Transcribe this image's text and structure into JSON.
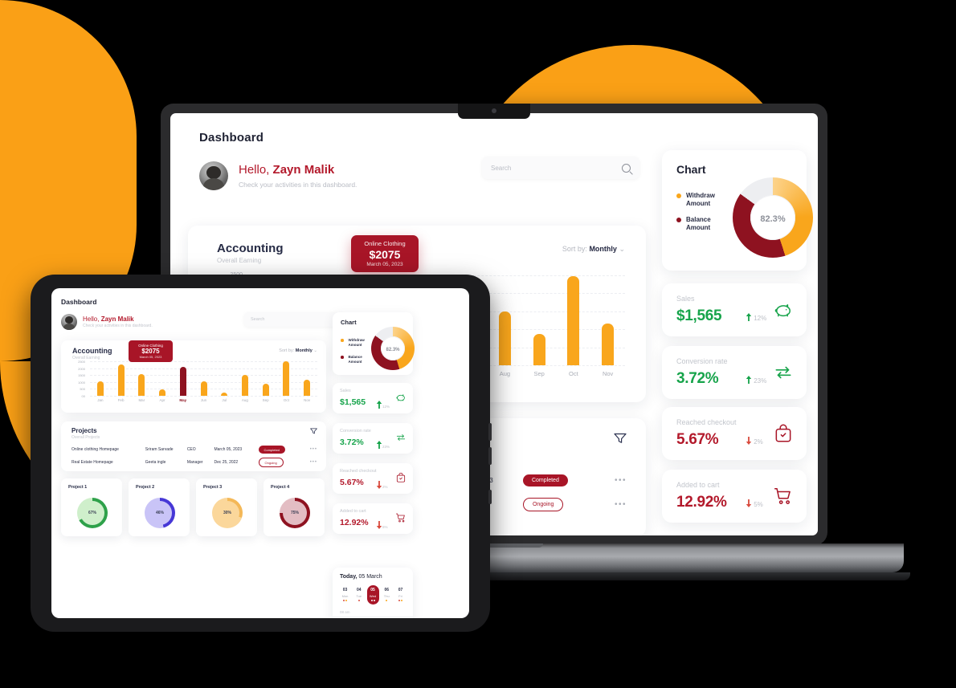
{
  "brand": {
    "orange": "#FAA016",
    "red": "#A81527",
    "dark_red": "#8E1220",
    "green": "#17A44B",
    "navy": "#262b45"
  },
  "app": {
    "page_title": "Dashboard",
    "greeting_prefix": "Hello,",
    "user_name": "Zayn Malik",
    "greeting_sub": "Check your activities in this dashboard."
  },
  "search": {
    "placeholder": "Search",
    "icon": "search-icon"
  },
  "accounting": {
    "title": "Accounting",
    "subtitle": "Overall Earning",
    "sort_label": "Sort by:",
    "sort_value": "Monthly",
    "sort_caret": "⌄",
    "tooltip": {
      "label": "Online Clothing",
      "value": "$2075",
      "date": "March 05, 2023"
    }
  },
  "chart_data": {
    "type": "bar",
    "title": "Accounting",
    "subtitle": "Overall Earning",
    "xlabel": "",
    "ylabel": "",
    "ylim": [
      0,
      2500
    ],
    "yticks": [
      "2500",
      "2000",
      "1500",
      "1000",
      "500",
      "00"
    ],
    "grid": true,
    "categories": [
      "Jan",
      "Feb",
      "Mar",
      "Apr",
      "May",
      "Jun",
      "Jul",
      "Aug",
      "Sep",
      "Oct",
      "Nov"
    ],
    "values": [
      1020,
      2280,
      1580,
      450,
      2075,
      1030,
      230,
      1490,
      880,
      2480,
      1150
    ],
    "highlight_index": 4,
    "bar_color": "#F9A61C",
    "highlight_color": "#8E1220",
    "legend": []
  },
  "donut_chart": {
    "title": "Chart",
    "center_value": "82.3",
    "center_unit": "%",
    "legend": [
      {
        "label_line1": "Withdraw",
        "label_line2": "Amount",
        "color": "#F9A61C",
        "value": 45
      },
      {
        "label_line1": "Balance",
        "label_line2": "Amount",
        "color": "#8E1220",
        "value": 40
      }
    ],
    "track_color": "#EDEEF1"
  },
  "stats": [
    {
      "label": "Sales",
      "value": "$1,565",
      "delta": "12%",
      "direction": "up",
      "tone": "green",
      "icon": "piggy-bank-icon"
    },
    {
      "label": "Conversion rate",
      "value": "3.72%",
      "delta": "23%",
      "direction": "up",
      "tone": "green",
      "icon": "exchange-arrows-icon"
    },
    {
      "label": "Reached checkout",
      "value": "5.67%",
      "delta": "2%",
      "direction": "down",
      "tone": "red",
      "icon": "checkout-bag-icon"
    },
    {
      "label": "Added to cart",
      "value": "12.92%",
      "delta": "5%",
      "direction": "down",
      "tone": "red",
      "icon": "shopping-cart-icon"
    }
  ],
  "projects": {
    "title": "Projects",
    "subtitle": "Overall Projects",
    "filter_icon": "funnel-filter-icon",
    "rows": [
      {
        "name": "Online clothing Homepage",
        "owner": "Sriram Sarvade",
        "role": "CEO",
        "date": "March 05, 2023",
        "status": "Completed",
        "status_kind": "completed",
        "menu": "•••"
      },
      {
        "name": "Real Estate Homepage",
        "owner": "Geeta ingle",
        "role": "Manager",
        "date": "Dec 25, 2022",
        "status": "Ongoing",
        "status_kind": "ongoing",
        "menu": "•••"
      }
    ]
  },
  "project_rings": [
    {
      "name": "Project 1",
      "percent": "67%",
      "value": 67,
      "color": "#2EA14A",
      "fill": "#CFEFCB"
    },
    {
      "name": "Project 2",
      "percent": "46%",
      "value": 46,
      "color": "#4637D6",
      "fill": "#C9C4F7"
    },
    {
      "name": "Project 3",
      "percent": "30%",
      "value": 30,
      "color": "#F4B857",
      "fill": "#FBD79B"
    },
    {
      "name": "Project 4",
      "percent": "75%",
      "value": 75,
      "color": "#8E1220",
      "fill": "#E3BDC3"
    }
  ],
  "calendar": {
    "title_prefix": "Today,",
    "title_date": "05 March",
    "time_label": "08 am",
    "days": [
      {
        "num": "03",
        "name": "Mon",
        "selected": false,
        "dots": [
          "#D94A3D",
          "#F9A61C"
        ]
      },
      {
        "num": "04",
        "name": "Tue",
        "selected": false,
        "dots": [
          "#D94A3D"
        ]
      },
      {
        "num": "05",
        "name": "Wed",
        "selected": true,
        "dots": [
          "#ffffff",
          "#ffffff"
        ]
      },
      {
        "num": "06",
        "name": "Thu",
        "selected": false,
        "dots": [
          "#F9A61C"
        ]
      },
      {
        "num": "07",
        "name": "Fri",
        "selected": false,
        "dots": [
          "#D94A3D",
          "#F9A61C"
        ]
      }
    ]
  }
}
